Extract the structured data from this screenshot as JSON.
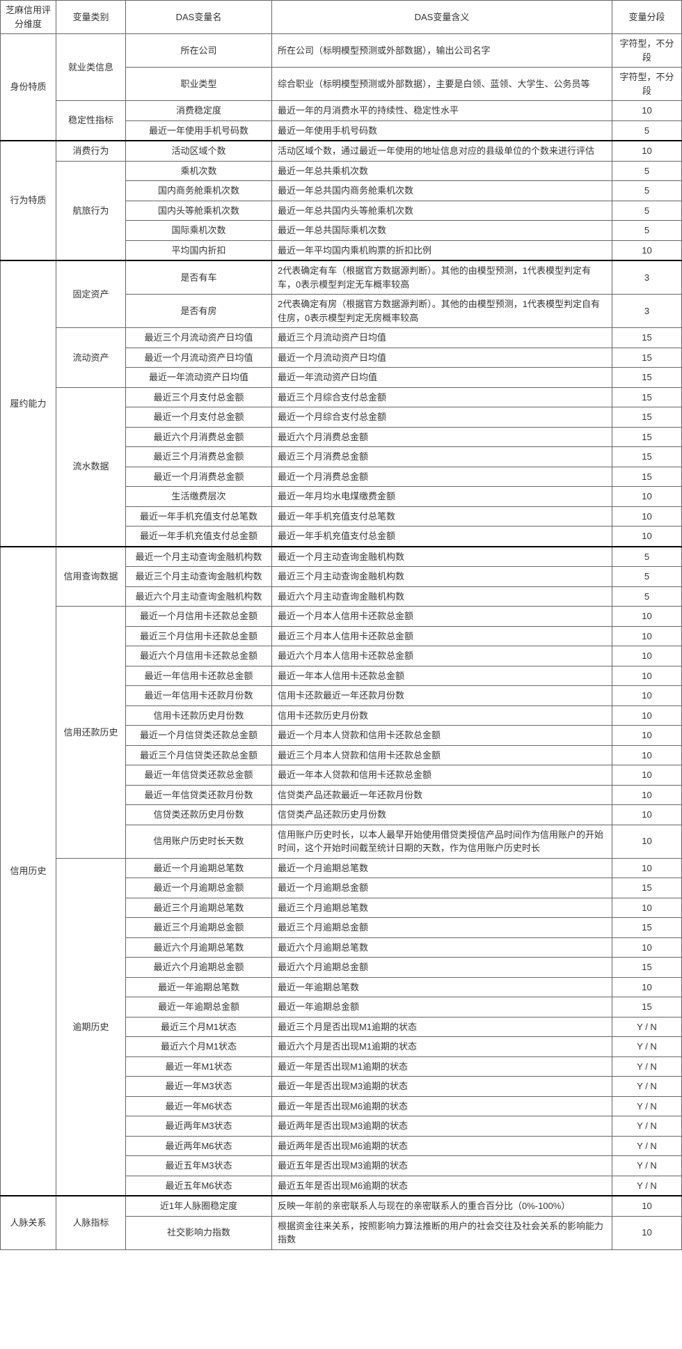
{
  "headers": {
    "dim": "芝麻信用评分维度",
    "cat": "变量类别",
    "var": "DAS变量名",
    "meaning": "DAS变量含义",
    "seg": "变量分段"
  },
  "sections": [
    {
      "dim": "身份特质",
      "groups": [
        {
          "cat": "就业类信息",
          "rows": [
            {
              "v": "所在公司",
              "m": "所在公司（标明模型预测或外部数据），输出公司名字",
              "s": "字符型，不分段"
            },
            {
              "v": "职业类型",
              "m": "综合职业（标明模型预测或外部数据），主要是白领、蓝领、大学生、公务员等",
              "s": "字符型，不分段"
            }
          ]
        },
        {
          "cat": "稳定性指标",
          "rows": [
            {
              "v": "消费稳定度",
              "m": "最近一年的月消费水平的持续性、稳定性水平",
              "s": "10"
            },
            {
              "v": "最近一年使用手机号码数",
              "m": "最近一年使用手机号码数",
              "s": "5"
            }
          ]
        }
      ]
    },
    {
      "dim": "行为特质",
      "groups": [
        {
          "cat": "消费行为",
          "rows": [
            {
              "v": "活动区域个数",
              "m": "活动区域个数，通过最近一年使用的地址信息对应的县级单位的个数来进行评估",
              "s": "10"
            }
          ]
        },
        {
          "cat": "航旅行为",
          "rows": [
            {
              "v": "乘机次数",
              "m": "最近一年总共乘机次数",
              "s": "5"
            },
            {
              "v": "国内商务舱乘机次数",
              "m": "最近一年总共国内商务舱乘机次数",
              "s": "5"
            },
            {
              "v": "国内头等舱乘机次数",
              "m": "最近一年总共国内头等舱乘机次数",
              "s": "5"
            },
            {
              "v": "国际乘机次数",
              "m": "最近一年总共国际乘机次数",
              "s": "5"
            },
            {
              "v": "平均国内折扣",
              "m": "最近一年平均国内乘机购票的折扣比例",
              "s": "10"
            }
          ]
        }
      ]
    },
    {
      "dim": "履约能力",
      "groups": [
        {
          "cat": "固定资产",
          "rows": [
            {
              "v": "是否有车",
              "m": "2代表确定有车（根据官方数据源判断）。其他的由模型预测，1代表模型判定有车，0表示模型判定无车概率较高",
              "s": "3"
            },
            {
              "v": "是否有房",
              "m": "2代表确定有房（根据官方数据源判断）。其他的由模型预测，1代表模型判定自有住房，0表示模型判定无房概率较高",
              "s": "3"
            }
          ]
        },
        {
          "cat": "流动资产",
          "rows": [
            {
              "v": "最近三个月流动资产日均值",
              "m": "最近三个月流动资产日均值",
              "s": "15"
            },
            {
              "v": "最近一个月流动资产日均值",
              "m": "最近一个月流动资产日均值",
              "s": "15"
            },
            {
              "v": "最近一年流动资产日均值",
              "m": "最近一年流动资产日均值",
              "s": "15"
            }
          ]
        },
        {
          "cat": "流水数据",
          "rows": [
            {
              "v": "最近三个月支付总金额",
              "m": "最近三个月综合支付总金额",
              "s": "15"
            },
            {
              "v": "最近一个月支付总金额",
              "m": "最近一个月综合支付总金额",
              "s": "15"
            },
            {
              "v": "最近六个月消费总金额",
              "m": "最近六个月消费总金额",
              "s": "15"
            },
            {
              "v": "最近三个月消费总金额",
              "m": "最近三个月消费总金额",
              "s": "15"
            },
            {
              "v": "最近一个月消费总金额",
              "m": "最近一个月消费总金额",
              "s": "15"
            },
            {
              "v": "生活缴费层次",
              "m": "最近一年月均水电煤缴费金额",
              "s": "10"
            },
            {
              "v": "最近一年手机充值支付总笔数",
              "m": "最近一年手机充值支付总笔数",
              "s": "10"
            },
            {
              "v": "最近一年手机充值支付总金额",
              "m": "最近一年手机充值支付总金额",
              "s": "10"
            }
          ]
        }
      ]
    },
    {
      "dim": "信用历史",
      "groups": [
        {
          "cat": "信用查询数据",
          "rows": [
            {
              "v": "最近一个月主动查询金融机构数",
              "m": "最近一个月主动查询金融机构数",
              "s": "5"
            },
            {
              "v": "最近三个月主动查询金融机构数",
              "m": "最近三个月主动查询金融机构数",
              "s": "5"
            },
            {
              "v": "最近六个月主动查询金融机构数",
              "m": "最近六个月主动查询金融机构数",
              "s": "5"
            }
          ]
        },
        {
          "cat": "信用还款历史",
          "rows": [
            {
              "v": "最近一个月信用卡还款总金额",
              "m": "最近一个月本人信用卡还款总金额",
              "s": "10"
            },
            {
              "v": "最近三个月信用卡还款总金额",
              "m": "最近三个月本人信用卡还款总金额",
              "s": "10"
            },
            {
              "v": "最近六个月信用卡还款总金额",
              "m": "最近六个月本人信用卡还款总金额",
              "s": "10"
            },
            {
              "v": "最近一年信用卡还款总金额",
              "m": "最近一年本人信用卡还款总金额",
              "s": "10"
            },
            {
              "v": "最近一年信用卡还款月份数",
              "m": "信用卡还款最近一年还款月份数",
              "s": "10"
            },
            {
              "v": "信用卡还款历史月份数",
              "m": "信用卡还款历史月份数",
              "s": "10"
            },
            {
              "v": "最近一个月信贷类还款总金额",
              "m": "最近一个月本人贷款和信用卡还款总金额",
              "s": "10"
            },
            {
              "v": "最近三个月信贷类还款总金额",
              "m": "最近三个月本人贷款和信用卡还款总金额",
              "s": "10"
            },
            {
              "v": "最近一年信贷类还款总金额",
              "m": "最近一年本人贷款和信用卡还款总金额",
              "s": "10"
            },
            {
              "v": "最近一年信贷类还款月份数",
              "m": "信贷类产品还款最近一年还款月份数",
              "s": "10"
            },
            {
              "v": "信贷类还款历史月份数",
              "m": "信贷类产品还款历史月份数",
              "s": "10"
            },
            {
              "v": "信用账户历史时长天数",
              "m": "信用账户历史时长，以本人最早开始使用借贷类授信产品时间作为信用账户的开始时间，这个开始时间截至统计日期的天数，作为信用账户历史时长",
              "s": "10"
            }
          ]
        },
        {
          "cat": "逾期历史",
          "rows": [
            {
              "v": "最近一个月逾期总笔数",
              "m": "最近一个月逾期总笔数",
              "s": "10"
            },
            {
              "v": "最近一个月逾期总金额",
              "m": "最近一个月逾期总金额",
              "s": "15"
            },
            {
              "v": "最近三个月逾期总笔数",
              "m": "最近三个月逾期总笔数",
              "s": "10"
            },
            {
              "v": "最近三个月逾期总金额",
              "m": "最近三个月逾期总金额",
              "s": "15"
            },
            {
              "v": "最近六个月逾期总笔数",
              "m": "最近六个月逾期总笔数",
              "s": "10"
            },
            {
              "v": "最近六个月逾期总金额",
              "m": "最近六个月逾期总金额",
              "s": "15"
            },
            {
              "v": "最近一年逾期总笔数",
              "m": "最近一年逾期总笔数",
              "s": "10"
            },
            {
              "v": "最近一年逾期总金额",
              "m": "最近一年逾期总金额",
              "s": "15"
            },
            {
              "v": "最近三个月M1状态",
              "m": "最近三个月是否出现M1逾期的状态",
              "s": "Y / N"
            },
            {
              "v": "最近六个月M1状态",
              "m": "最近六个月是否出现M1逾期的状态",
              "s": "Y / N"
            },
            {
              "v": "最近一年M1状态",
              "m": "最近一年是否出现M1逾期的状态",
              "s": "Y / N"
            },
            {
              "v": "最近一年M3状态",
              "m": "最近一年是否出现M3逾期的状态",
              "s": "Y / N"
            },
            {
              "v": "最近一年M6状态",
              "m": "最近一年是否出现M6逾期的状态",
              "s": "Y / N"
            },
            {
              "v": "最近两年M3状态",
              "m": "最近两年是否出现M3逾期的状态",
              "s": "Y / N"
            },
            {
              "v": "最近两年M6状态",
              "m": "最近两年是否出现M6逾期的状态",
              "s": "Y / N"
            },
            {
              "v": "最近五年M3状态",
              "m": "最近五年是否出现M3逾期的状态",
              "s": "Y / N"
            },
            {
              "v": "最近五年M6状态",
              "m": "最近五年是否出现M6逾期的状态",
              "s": "Y / N"
            }
          ]
        }
      ]
    },
    {
      "dim": "人脉关系",
      "groups": [
        {
          "cat": "人脉指标",
          "rows": [
            {
              "v": "近1年人脉圈稳定度",
              "m": "反映一年前的亲密联系人与现在的亲密联系人的重合百分比（0%-100%）",
              "s": "10"
            },
            {
              "v": "社交影响力指数",
              "m": "根据资金往来关系，按照影响力算法推断的用户的社会交往及社会关系的影响能力指数",
              "s": "10"
            }
          ]
        }
      ]
    }
  ]
}
